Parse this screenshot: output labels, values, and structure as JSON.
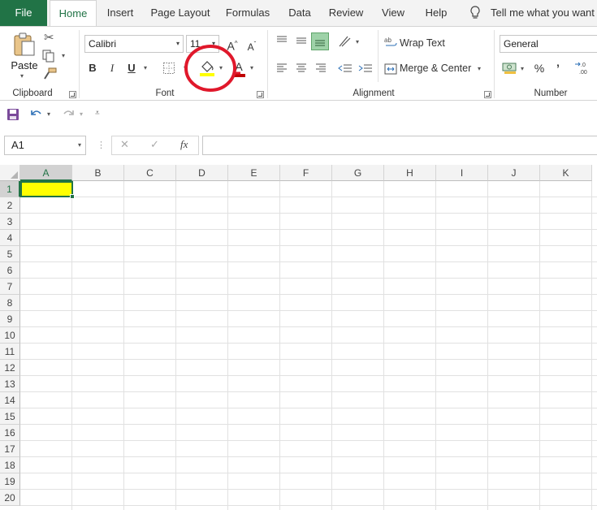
{
  "tabs": {
    "file": "File",
    "home": "Home",
    "insert": "Insert",
    "page_layout": "Page Layout",
    "formulas": "Formulas",
    "data": "Data",
    "review": "Review",
    "view": "View",
    "help": "Help",
    "tell_me": "Tell me what you want to"
  },
  "ribbon": {
    "clipboard": {
      "paste_label": "Paste",
      "group_label": "Clipboard"
    },
    "font": {
      "font_name": "Calibri",
      "font_size": "11",
      "grow_label": "A",
      "shrink_label": "A",
      "bold_label": "B",
      "italic_label": "I",
      "underline_label": "U",
      "font_color_label": "A",
      "group_label": "Font",
      "fill_color": "#FFFF00",
      "font_color": "#C00000",
      "annotation_color": "#E0182B"
    },
    "alignment": {
      "wrap_text_label": "Wrap Text",
      "merge_center_label": "Merge & Center",
      "group_label": "Alignment"
    },
    "number": {
      "format_value": "General",
      "percent_label": "%",
      "comma_label": "’",
      "group_label": "Number"
    }
  },
  "formula_bar": {
    "name_box": "A1",
    "fx_label": "fx",
    "cancel_label": "✕",
    "enter_label": "✓",
    "formula_value": ""
  },
  "sheet": {
    "columns": [
      "A",
      "B",
      "C",
      "D",
      "E",
      "F",
      "G",
      "H",
      "I",
      "J",
      "K"
    ],
    "rows": [
      "1",
      "2",
      "3",
      "4",
      "5",
      "6",
      "7",
      "8",
      "9",
      "10",
      "11",
      "12",
      "13",
      "14",
      "15",
      "16",
      "17",
      "18",
      "19",
      "20"
    ],
    "selected_cell": "A1",
    "selected_cell_fill": "#FFFF00"
  },
  "colors": {
    "excel_green": "#217346",
    "fill_highlight": "#FFFF00",
    "annotation_circle": "#E0182B"
  }
}
